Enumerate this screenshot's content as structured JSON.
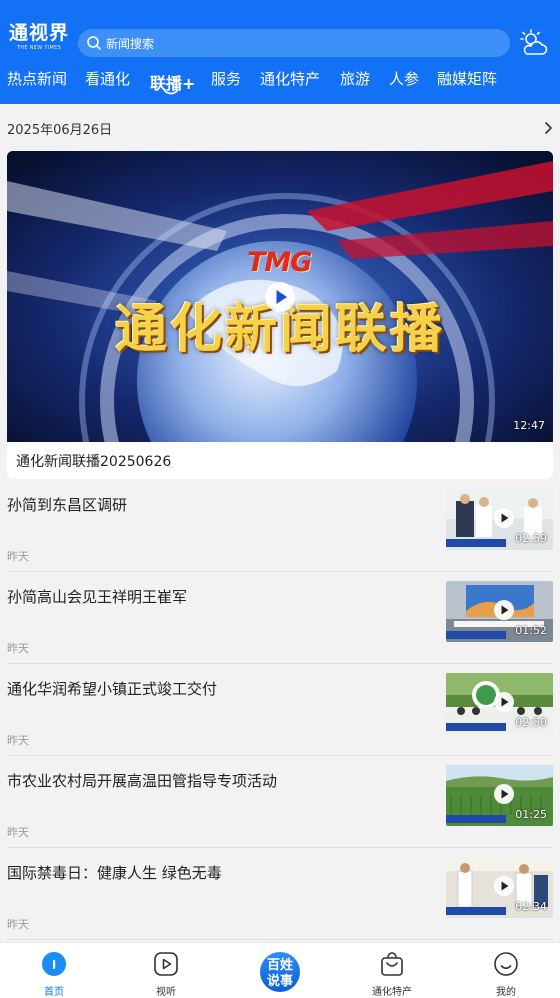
{
  "header": {
    "logo_main": "通视界",
    "logo_sub": "THE NEW TIMES",
    "search_placeholder": "新闻搜索",
    "weather_icon": "weather-cloud-sun-icon",
    "colors": {
      "brand": "#1271f5",
      "search_bg": "#3f8ff8"
    }
  },
  "nav": {
    "tabs": [
      {
        "label": "热点新闻",
        "active": false
      },
      {
        "label": "看通化",
        "active": false
      },
      {
        "label": "联播+",
        "active": true
      },
      {
        "label": "服务",
        "active": false
      },
      {
        "label": "通化特产",
        "active": false
      },
      {
        "label": "旅游",
        "active": false
      },
      {
        "label": "人参",
        "active": false
      },
      {
        "label": "融媒矩阵",
        "active": false
      }
    ]
  },
  "date_row": {
    "date": "2025年06月26日"
  },
  "featured": {
    "image_text_logo": "TMG",
    "image_text_title": "通化新闻联播",
    "duration": "12:47",
    "caption": "通化新闻联播20250626"
  },
  "news": [
    {
      "title": "孙简到东昌区调研",
      "time": "昨天",
      "duration": "02:59"
    },
    {
      "title": "孙简高山会见王祥明王崔军",
      "time": "昨天",
      "duration": "01:52"
    },
    {
      "title": "通化华润希望小镇正式竣工交付",
      "time": "昨天",
      "duration": "02:50"
    },
    {
      "title": "市农业农村局开展高温田管指导专项活动",
      "time": "昨天",
      "duration": "01:25"
    },
    {
      "title": "国际禁毒日：健康人生 绿色无毒",
      "time": "昨天",
      "duration": "02:34"
    }
  ],
  "tabbar": {
    "tabs": [
      {
        "label": "首页",
        "icon": "home-icon",
        "active": true
      },
      {
        "label": "视听",
        "icon": "play-circle-icon",
        "active": false
      },
      {
        "label": "百姓说事",
        "icon": "baixing-shuoshi-icon",
        "active": false
      },
      {
        "label": "通化特产",
        "icon": "shopping-bag-icon",
        "active": false
      },
      {
        "label": "我的",
        "icon": "smile-face-icon",
        "active": false
      }
    ]
  }
}
